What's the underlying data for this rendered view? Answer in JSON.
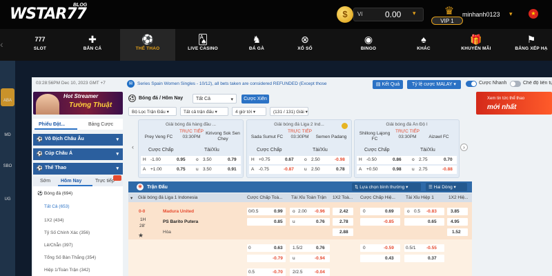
{
  "brand": {
    "logo": "WSTAR77",
    "tag": "BLOG"
  },
  "header": {
    "coin_glyph": "$",
    "wallet_label": "Ví",
    "balance": "0.00",
    "vip": "VIP 1",
    "username": "minhanh0123"
  },
  "nav": [
    {
      "label": "SLOT",
      "icon": "slot-icon",
      "glyph": "777"
    },
    {
      "label": "BẮN CÁ",
      "icon": "fish-icon",
      "glyph": "✚"
    },
    {
      "label": "THỂ THAO",
      "icon": "soccer-ball-icon",
      "glyph": "⚽"
    },
    {
      "label": "LIVE CASINO",
      "icon": "cards-icon",
      "glyph": "🂡"
    },
    {
      "label": "ĐÁ GÀ",
      "icon": "rooster-icon",
      "glyph": "♞"
    },
    {
      "label": "XỔ SỐ",
      "icon": "lottery-icon",
      "glyph": "⊗"
    },
    {
      "label": "BINGO",
      "icon": "bingo-icon",
      "glyph": "◉"
    },
    {
      "label": "KHÁC",
      "icon": "other-icon",
      "glyph": "♠"
    },
    {
      "label": "KHUYẾN MÃI",
      "icon": "gift-icon",
      "glyph": "🎁"
    },
    {
      "label": "BẢNG XẾP HẠ",
      "icon": "leaderboard-icon",
      "glyph": "⚑"
    }
  ],
  "side": {
    "items": [
      "ABA",
      "MD",
      "SBO",
      "UG"
    ]
  },
  "topline": {
    "clock": "03:28:56PM Dec 10, 2023 GMT +7",
    "ticker": "Series Spain Women Singles - 10/12), all bets taken are considered REFUNDED (Except those",
    "btn_result": "Kết Quả",
    "btn_odds": "Tỷ lệ cược MALAY",
    "toggle_fast": "Cược Nhanh",
    "toggle_mode": "Chế độ liên tục"
  },
  "left": {
    "banner_t1": "Hot Streamer",
    "banner_t2": "Tường Thuật",
    "tab_slip": "Phiếu Đặt...",
    "tab_table": "Bảng Cược",
    "sections": [
      "Vô Địch Châu Âu",
      "Cúp Châu Á",
      "Thể Thao"
    ],
    "subtabs": [
      "Sớm",
      "Hôm Nay",
      "Trực tiếp"
    ],
    "menu": [
      "Bóng đá (694)",
      "Tất Cả (653)",
      "1X2 (434)",
      "Tỷ Số Chính Xác (356)",
      "Lẻ/Chẵn (397)",
      "Tổng Số Bàn Thắng (354)",
      "Hiệp 1/Toàn Trận (342)"
    ]
  },
  "center": {
    "crumb": "Bóng đá / Hôm Nay",
    "select_all": "Tất Cả",
    "btn_parlay": "Cược Xiên",
    "filters": [
      "Bộ Lọc Trận Đấu",
      "Tất cả trận đấu",
      "4 giờ tới",
      "(131 / 131) Giải"
    ]
  },
  "cards": [
    {
      "league": "Giải bóng đá hàng đầu ...",
      "home": "Prey Veng FC",
      "away": "Kirivong Sok Sen Chey",
      "live": "TRỰC TIẾP",
      "time": "03:30PM",
      "h1": "Cược Chấp",
      "h2": "Tài/Xỉu",
      "r1": [
        "H",
        "-1.00",
        "0.95",
        "o",
        "3.50",
        "0.79"
      ],
      "r2": [
        "A",
        "+1.00",
        "0.75",
        "u",
        "3.50",
        "0.91"
      ]
    },
    {
      "league": "Giải bóng đá Liga 2 Ind...",
      "home": "Sada Sumut FC",
      "away": "Semen Padang",
      "live": "TRỰC TIẾP",
      "time": "03:30PM",
      "h1": "Cược Chấp",
      "h2": "Tài/Xỉu",
      "r1": [
        "H",
        "+0.75",
        "0.67",
        "o",
        "2.50",
        "-0.98"
      ],
      "r2": [
        "A",
        "-0.75",
        "-0.87",
        "u",
        "2.50",
        "0.78"
      ]
    },
    {
      "league": "Giải bóng đá Ấn Độ I",
      "home": "Shillong Lajong FC",
      "away": "Aizawl FC",
      "live": "TRỰC TIẾP",
      "time": "03:30PM",
      "h1": "Cược Chấp",
      "h2": "Tài/Xỉu",
      "r1": [
        "H",
        "-0.50",
        "0.86",
        "o",
        "2.75",
        "0.70"
      ],
      "r2": [
        "A",
        "+0.50",
        "0.98",
        "u",
        "2.75",
        "-0.88"
      ]
    }
  ],
  "table": {
    "title": "Trận Đấu",
    "sort": "Lựa chọn bình thường",
    "view": "Hai Dòng",
    "league": "Giải bóng đá Liga 1 Indonesia",
    "cols": [
      "Cược Chấp Toà...",
      "Tài Xỉu Toàn Trận",
      "1X2 Toà...",
      "Cược Chấp Hiệ...",
      "Tài Xỉu Hiệp 1",
      "1X2 Hiệ..."
    ],
    "match": {
      "score": "0-0",
      "half": "1H",
      "minute": "28'",
      "home": "Madura United",
      "away": "PS Barito Putera",
      "draw": "Hòa"
    },
    "r1": [
      "0/0.5",
      "0.99",
      "o",
      "2.00",
      "-0.96",
      "2.42",
      "0",
      "0.69",
      "o",
      "0.5",
      "-0.83",
      "3.85"
    ],
    "r2": [
      "0.85",
      "u",
      "0.76",
      "2.78",
      "-0.85",
      "0.65",
      "4.95"
    ],
    "r3": [
      "2.88",
      "1.52"
    ],
    "r4": [
      "0",
      "0.63",
      "1.5/2",
      "0.76",
      "0",
      "-0.59",
      "0.5/1",
      "-0.55"
    ],
    "r5": [
      "-0.79",
      "u",
      "-0.94",
      "0.43",
      "0.37"
    ],
    "r6": [
      "0.5",
      "-0.70",
      "2/2.5",
      "-0.04"
    ]
  },
  "right": {
    "b1": "Xem tin tức thể thao",
    "b2": "mới nhất"
  },
  "colors": {
    "accent": "#e6a21a",
    "blue": "#2b72c5",
    "header": "#2f6aa8",
    "negative": "#e64a2e",
    "live": "#e64a2e"
  }
}
